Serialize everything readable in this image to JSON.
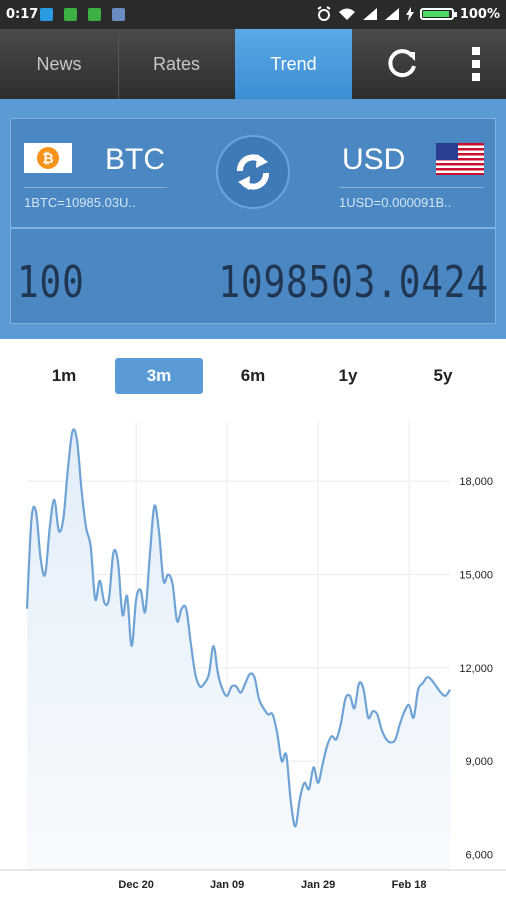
{
  "status_bar": {
    "time": "0:17",
    "battery_pct": "100%",
    "battery_level": 1.0
  },
  "tabs": [
    {
      "label": "News",
      "active": false
    },
    {
      "label": "Rates",
      "active": false
    },
    {
      "label": "Trend",
      "active": true
    }
  ],
  "toolbar": {
    "refresh_icon": "refresh-icon",
    "menu_icon": "overflow-menu-icon"
  },
  "converter": {
    "from": {
      "code": "BTC",
      "rate_text": "1BTC=10985.03U..",
      "icon": "bitcoin-logo"
    },
    "to": {
      "code": "USD",
      "rate_text": "1USD=0.000091B..",
      "icon": "us-flag"
    },
    "swap_icon": "swap-icon",
    "amount": "100",
    "result": "1098503.0424"
  },
  "periods": [
    {
      "label": "1m",
      "active": false
    },
    {
      "label": "3m",
      "active": true
    },
    {
      "label": "6m",
      "active": false
    },
    {
      "label": "1y",
      "active": false
    },
    {
      "label": "5y",
      "active": false
    }
  ],
  "colors": {
    "accent": "#5b9bd5",
    "line": "#6fa3d6",
    "area": "#e3eefa"
  },
  "chart_data": {
    "type": "area",
    "title": "",
    "xlabel": "",
    "ylabel": "",
    "x_ticks": [
      "Dec 20",
      "Jan 09",
      "Jan 29",
      "Feb 18"
    ],
    "y_ticks": [
      "6,000",
      "9,000",
      "12,000",
      "15,000",
      "18,000"
    ],
    "ylim": [
      5500,
      19900
    ],
    "x": [
      "Nov 26",
      "Nov 27",
      "Nov 28",
      "Nov 29",
      "Nov 30",
      "Dec 01",
      "Dec 02",
      "Dec 03",
      "Dec 04",
      "Dec 05",
      "Dec 06",
      "Dec 07",
      "Dec 08",
      "Dec 09",
      "Dec 10",
      "Dec 11",
      "Dec 12",
      "Dec 13",
      "Dec 14",
      "Dec 15",
      "Dec 16",
      "Dec 17",
      "Dec 18",
      "Dec 19",
      "Dec 20",
      "Dec 21",
      "Dec 22",
      "Dec 23",
      "Dec 24",
      "Dec 25",
      "Dec 26",
      "Dec 27",
      "Dec 28",
      "Dec 29",
      "Dec 30",
      "Dec 31",
      "Jan 01",
      "Jan 02",
      "Jan 03",
      "Jan 04",
      "Jan 05",
      "Jan 06",
      "Jan 07",
      "Jan 08",
      "Jan 09",
      "Jan 10",
      "Jan 11",
      "Jan 12",
      "Jan 13",
      "Jan 14",
      "Jan 15",
      "Jan 16",
      "Jan 17",
      "Jan 18",
      "Jan 19",
      "Jan 20",
      "Jan 21",
      "Jan 22",
      "Jan 23",
      "Jan 24",
      "Jan 25",
      "Jan 26",
      "Jan 27",
      "Jan 28",
      "Jan 29",
      "Jan 30",
      "Jan 31",
      "Feb 01",
      "Feb 02",
      "Feb 03",
      "Feb 04",
      "Feb 05",
      "Feb 06",
      "Feb 07",
      "Feb 08",
      "Feb 09",
      "Feb 10",
      "Feb 11",
      "Feb 12",
      "Feb 13",
      "Feb 14",
      "Feb 15",
      "Feb 16",
      "Feb 17",
      "Feb 18",
      "Feb 19",
      "Feb 20",
      "Feb 21",
      "Feb 22",
      "Feb 23",
      "Feb 24",
      "Feb 25",
      "Feb 26",
      "Feb 27"
    ],
    "series": [
      {
        "values": [
          13900,
          16800,
          17000,
          15500,
          15000,
          16500,
          17400,
          16400,
          16800,
          18400,
          19600,
          19300,
          17700,
          16500,
          15900,
          14200,
          14800,
          14100,
          14200,
          15700,
          15400,
          13700,
          14300,
          12700,
          14200,
          14500,
          13800,
          15600,
          17200,
          16400,
          14800,
          15000,
          14700,
          13500,
          13900,
          13900,
          12800,
          11800,
          11400,
          11500,
          11800,
          12700,
          11800,
          11300,
          11100,
          11400,
          11400,
          11200,
          11500,
          11800,
          11700,
          11000,
          10700,
          10500,
          10500,
          9900,
          9000,
          9200,
          7700,
          6900,
          7800,
          8300,
          8100,
          8800,
          8300,
          8900,
          9500,
          9800,
          9700,
          10200,
          11000,
          11100,
          10700,
          11500,
          11300,
          10400,
          10600,
          10500,
          10000,
          9700,
          9600,
          9700,
          10200,
          10600,
          10800,
          10400,
          11300,
          11500,
          11700,
          11600,
          11400,
          11200,
          11100,
          11300
        ]
      }
    ]
  }
}
